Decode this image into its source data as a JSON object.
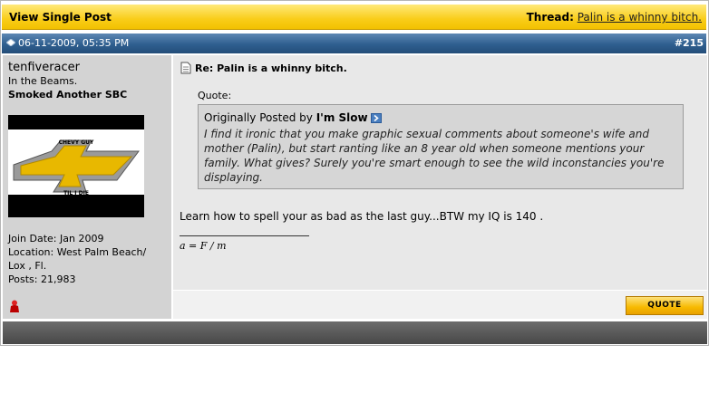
{
  "topbar": {
    "left": "View Single Post",
    "thread_label": "Thread:",
    "thread_title": "Palin is a whinny bitch."
  },
  "post": {
    "date": "06-11-2009, 05:35 PM",
    "number_prefix": "#",
    "number": "215",
    "title": "Re: Palin is a whinny bitch.",
    "quote_label": "Quote:",
    "quote_prefix": "Originally Posted by",
    "quote_author": "I'm Slow",
    "quote_text": "I find it ironic that you make graphic sexual comments about someone's wife and mother (Palin), but start ranting like an 8 year old when someone mentions your family. What gives? Surely you're smart enough to see the wild inconstancies you're displaying.",
    "body": "Learn how to spell your as bad as the last guy...BTW my IQ is 140 .",
    "signature": "a = F / m",
    "quote_button": "QUOTE"
  },
  "user": {
    "name": "tenfiveracer",
    "title": "In the Beams.",
    "custom": "Smoked Another SBC",
    "avatar_top": "CHEVY GUY",
    "avatar_bottom": "TIL I DIE",
    "join_date": "Join Date: Jan 2009",
    "location_line1": "Location: West Palm Beach/",
    "location_line2": "Lox , Fl.",
    "posts": "Posts: 21,983"
  },
  "colors": {
    "gold": "#f9cd19",
    "blue_header": "#2f5f8f",
    "user_panel": "#d3d3d3",
    "message_panel": "#e8e8e8"
  },
  "icons": {
    "date": "post-status-icon",
    "title": "document-icon",
    "quote_link": "view-post-arrow-icon",
    "user_status": "user-offline-icon"
  }
}
